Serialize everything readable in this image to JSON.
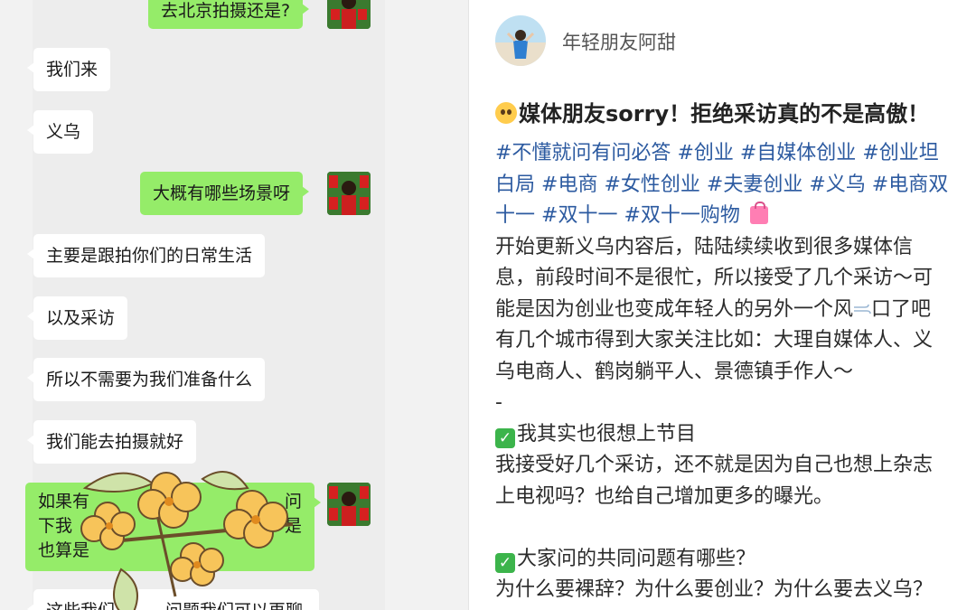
{
  "chat": {
    "messages": [
      {
        "side": "out",
        "text": "去北京拍摄还是?"
      },
      {
        "side": "in",
        "text": "我们来"
      },
      {
        "side": "in",
        "text": "义乌"
      },
      {
        "side": "out",
        "text": "大概有哪些场景呀"
      },
      {
        "side": "in",
        "text": "主要是跟拍你们的日常生活"
      },
      {
        "side": "in",
        "text": "以及采访"
      },
      {
        "side": "in",
        "text": "所以不需要为我们准备什么"
      },
      {
        "side": "in",
        "text": "我们能去拍摄就好"
      },
      {
        "side": "out",
        "line1": "如果有",
        "line1_right": "问",
        "line2": "下我",
        "line2_right": "是",
        "line3": "也算是"
      },
      {
        "side": "in",
        "text_left": "这些我们",
        "text_right": "问题我们可以再聊"
      }
    ]
  },
  "post": {
    "username": "年轻朋友阿甜",
    "title": "媒体朋友sorry！拒绝采访真的不是高傲！",
    "tags_line1": [
      "#不懂就问有问必答",
      "#创业",
      "#自媒体创业",
      "#创业坦"
    ],
    "tags_line2": [
      "白局",
      "#电商",
      "#女性创业",
      "#夫妻创业",
      "#义乌",
      "#电商双"
    ],
    "tags_line3": [
      "十一",
      "#双十一",
      "#双十一购物"
    ],
    "p1_l1": "开始更新义乌内容后，陆陆续续收到很多媒体信",
    "p1_l2": "息，前段时间不是很忙，所以接受了几个采访～可",
    "p1_l3a": "能是因为创业也变成年轻人的另外一个风",
    "p1_l3b": "口了吧",
    "p1_l4": "有几个城市得到大家关注比如：大理自媒体人、义",
    "p1_l5": "乌电商人、鹤岗躺平人、景德镇手作人～",
    "dash": "-",
    "h1": "我其实也很想上节目",
    "p2_l1": "我接受好几个采访，还不就是因为自己也想上杂志",
    "p2_l2": "上电视吗？也给自己增加更多的曝光。",
    "h2": "大家问的共同问题有哪些？",
    "p3_l1": "为什么要裸辞？为什么要创业？为什么要去义乌？"
  },
  "colors": {
    "tag": "#2c5aa0",
    "out_bubble": "#95ec69",
    "in_bubble": "#ffffff",
    "chat_bg": "#ededed"
  }
}
